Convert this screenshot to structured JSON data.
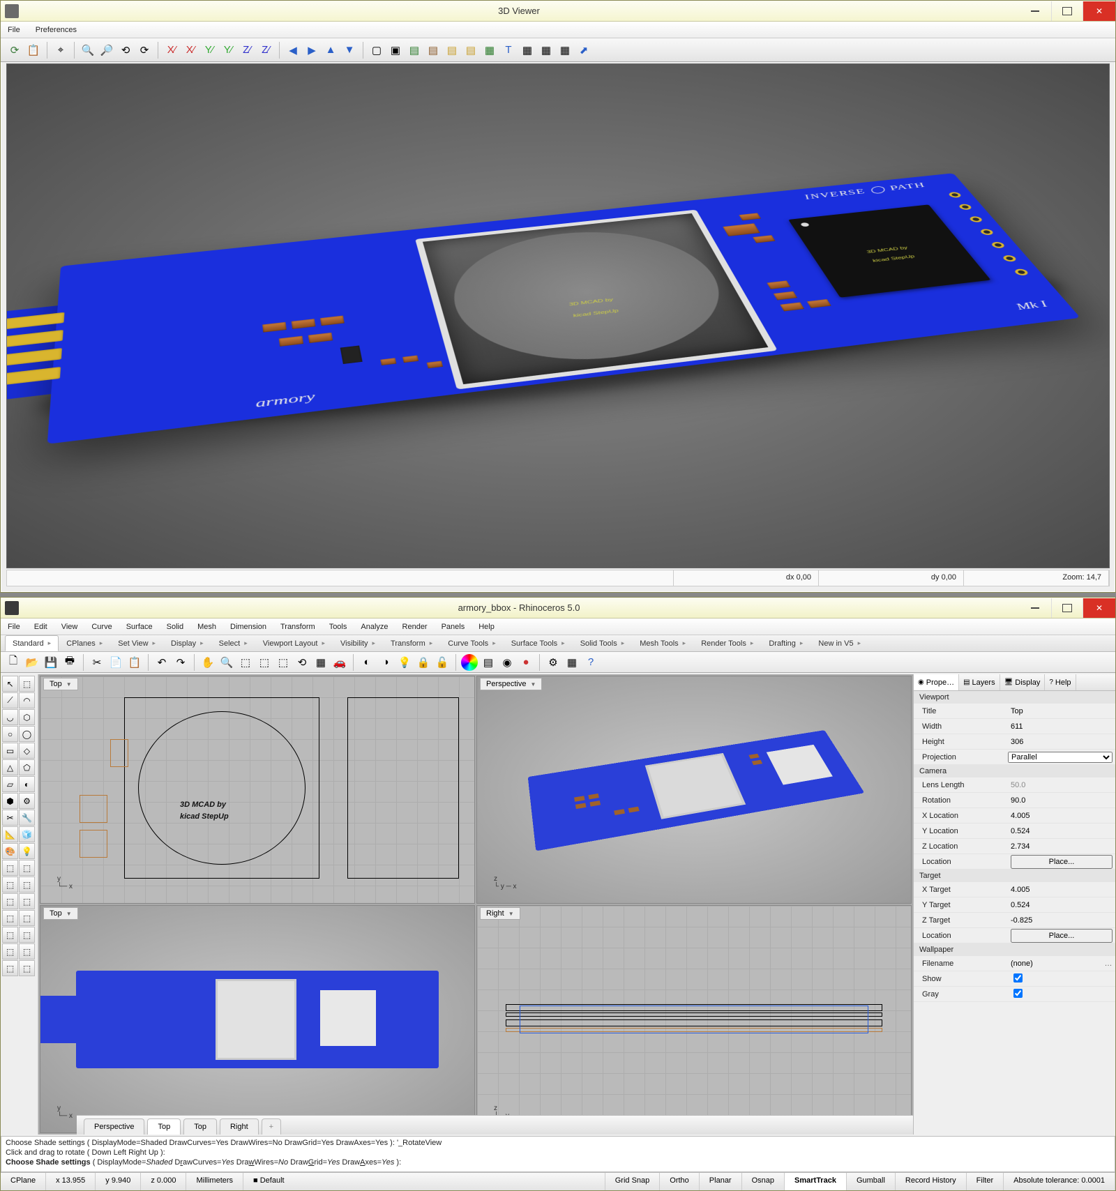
{
  "viewer3d": {
    "title": "3D Viewer",
    "menu": [
      "File",
      "Preferences"
    ],
    "status": {
      "dx": "dx 0,00",
      "dy": "dy 0,00",
      "zoom": "Zoom: 14,7"
    },
    "pcb": {
      "armory": "armory",
      "inverse": "INVERSE ◯ PATH",
      "mk": "Mk I",
      "chip_text1": "3D MCAD by",
      "chip_text2": "kicad StepUp"
    }
  },
  "rhino": {
    "title": "armory_bbox - Rhinoceros 5.0",
    "menu": [
      "File",
      "Edit",
      "View",
      "Curve",
      "Surface",
      "Solid",
      "Mesh",
      "Dimension",
      "Transform",
      "Tools",
      "Analyze",
      "Render",
      "Panels",
      "Help"
    ],
    "tabs": [
      "Standard",
      "CPlanes",
      "Set View",
      "Display",
      "Select",
      "Viewport Layout",
      "Visibility",
      "Transform",
      "Curve Tools",
      "Surface Tools",
      "Solid Tools",
      "Mesh Tools",
      "Render Tools",
      "Drafting",
      "New in V5"
    ],
    "viewport_labels": {
      "tl": "Top",
      "tr": "Perspective",
      "bl": "Top",
      "br": "Right"
    },
    "vp_tabs": [
      "Perspective",
      "Top",
      "Top",
      "Right"
    ],
    "vp_tab_active_index": 1,
    "vp_text1": "3D MCAD by",
    "vp_text2": "kicad StepUp",
    "panel_tabs": [
      "Prope…",
      "Layers",
      "Display",
      "Help"
    ],
    "props": {
      "grp_viewport": "Viewport",
      "title_k": "Title",
      "title_v": "Top",
      "width_k": "Width",
      "width_v": "611",
      "height_k": "Height",
      "height_v": "306",
      "proj_k": "Projection",
      "proj_v": "Parallel",
      "grp_camera": "Camera",
      "lens_k": "Lens Length",
      "lens_v": "50.0",
      "rot_k": "Rotation",
      "rot_v": "90.0",
      "xl_k": "X Location",
      "xl_v": "4.005",
      "yl_k": "Y Location",
      "yl_v": "0.524",
      "zl_k": "Z Location",
      "zl_v": "2.734",
      "loc_k": "Location",
      "loc_btn": "Place...",
      "grp_target": "Target",
      "xt_k": "X Target",
      "xt_v": "4.005",
      "yt_k": "Y Target",
      "yt_v": "0.524",
      "zt_k": "Z Target",
      "zt_v": "-0.825",
      "loc2_k": "Location",
      "loc2_btn": "Place...",
      "grp_wall": "Wallpaper",
      "fn_k": "Filename",
      "fn_v": "(none)",
      "show_k": "Show",
      "gray_k": "Gray"
    },
    "cmd": {
      "line1": "Choose Shade settings ( DisplayMode=Shaded  DrawCurves=Yes  DrawWires=No  DrawGrid=Yes  DrawAxes=Yes ): '_RotateView",
      "line2": "Click and drag to rotate ( Down  Left  Right  Up ):",
      "prompt": "Choose Shade settings",
      "opts": [
        "( DisplayMode=",
        "Shaded",
        "  D",
        "r",
        "awCurves=",
        "Yes",
        "  Dra",
        "w",
        "Wires=",
        "No",
        "  Draw",
        "G",
        "rid=",
        "Yes",
        "  Draw",
        "A",
        "xes=",
        "Yes",
        " ):"
      ]
    },
    "status": {
      "cells": [
        "CPlane",
        "x 13.955",
        "y 9.940",
        "z 0.000",
        "Millimeters",
        "■ Default",
        "Grid Snap",
        "Ortho",
        "Planar",
        "Osnap",
        "SmartTrack",
        "Gumball",
        "Record History",
        "Filter",
        "Absolute tolerance: 0.0001"
      ],
      "active_index": 10
    }
  }
}
